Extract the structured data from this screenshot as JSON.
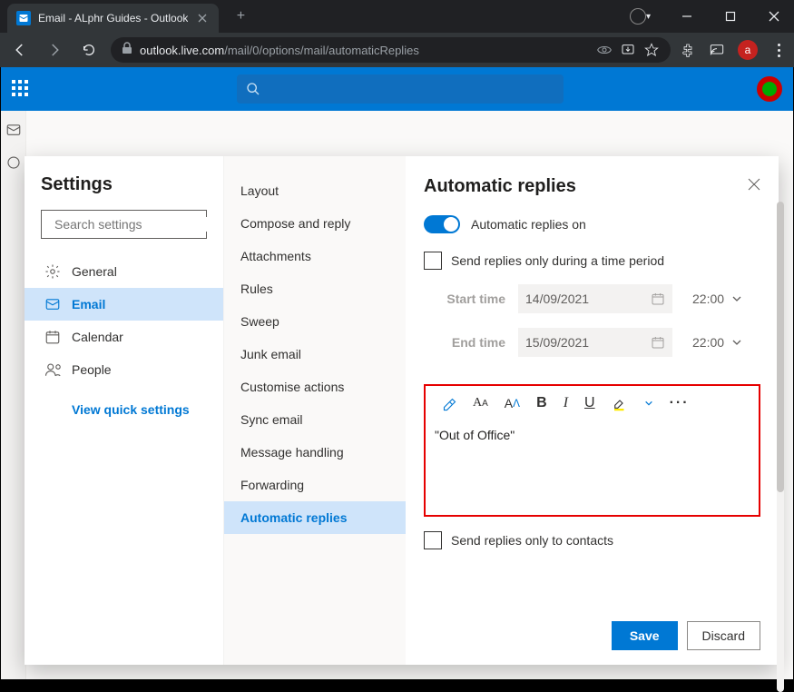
{
  "browser": {
    "tab_title": "Email - ALphr Guides - Outlook",
    "url_domain": "outlook.live.com",
    "url_path": "/mail/0/options/mail/automaticReplies",
    "avatar_letter": "a"
  },
  "settings": {
    "title": "Settings",
    "search_placeholder": "Search settings",
    "menu": {
      "general": "General",
      "email": "Email",
      "calendar": "Calendar",
      "people": "People"
    },
    "quick_link": "View quick settings"
  },
  "subnav": {
    "items": [
      "Layout",
      "Compose and reply",
      "Attachments",
      "Rules",
      "Sweep",
      "Junk email",
      "Customise actions",
      "Sync email",
      "Message handling",
      "Forwarding",
      "Automatic replies"
    ]
  },
  "panel": {
    "title": "Automatic replies",
    "toggle_label": "Automatic replies on",
    "time_period_label": "Send replies only during a time period",
    "start_label": "Start time",
    "end_label": "End time",
    "start_date": "14/09/2021",
    "end_date": "15/09/2021",
    "start_time": "22:00",
    "end_time": "22:00",
    "editor_content": "\"Out of Office\"",
    "contacts_only_label": "Send replies only to contacts",
    "save": "Save",
    "discard": "Discard"
  }
}
